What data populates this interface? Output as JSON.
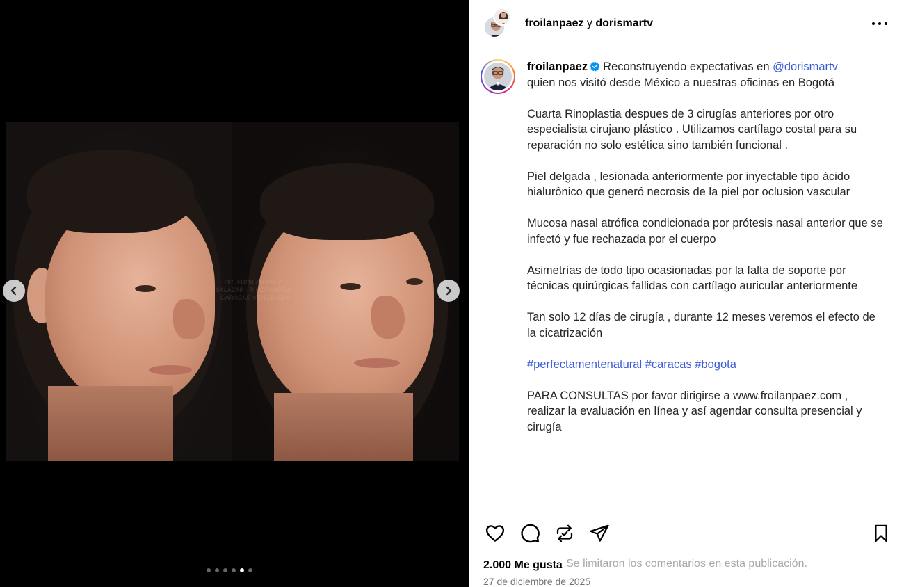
{
  "header": {
    "user1": "froilanpaez",
    "conjunction": "y",
    "user2": "dorismartv"
  },
  "icons": {
    "more": "more-horizontal-icon",
    "prev": "chevron-left-icon",
    "next": "chevron-right-icon",
    "verified": "verified-badge-icon",
    "like": "heart-icon",
    "comment": "comment-icon",
    "repost": "repost-icon",
    "share": "send-icon",
    "save": "bookmark-icon"
  },
  "media": {
    "dot_count": 6,
    "active_index": 4,
    "watermark": "DR. FROILAN PAEZ SALAZAR · RINOPLASTIA · CARACAS VENEZUELA"
  },
  "caption": {
    "username": "froilanpaez",
    "lead": "Reconstruyendo expectativas en ",
    "mention": "@dorismartv",
    "lead_rest": "quien nos visitó desde México a nuestras oficinas en Bogotá",
    "p2": "Cuarta Rinoplastia despues de 3 cirugías anteriores por otro especialista cirujano plástico . Utilizamos cartílago costal para su reparación no solo estética sino también funcional .",
    "p3": "Piel delgada , lesionada anteriormente por inyectable tipo ácido hialurônico que generó necrosis de la piel por oclusion vascular",
    "p4": "Mucosa nasal atrófica condicionada por prótesis nasal anterior que se infectó y fue rechazada por el cuerpo",
    "p5": "Asimetrías de todo tipo ocasionadas por la falta de soporte por técnicas quirúrgicas fallidas con cartílago auricular anteriormente",
    "p6": "Tan solo 12 días de cirugía , durante 12 meses veremos el efecto de la cicatrización",
    "hashtags": [
      "#perfectamentenatural",
      "#caracas",
      "#bogota"
    ],
    "p8": "PARA CONSULTAS por favor dirigirse a www.froilanpaez.com , realizar la evaluación en línea y así agendar consulta presencial y cirugía"
  },
  "stats": {
    "likes": "2.000 Me gusta",
    "date": "27 de diciembre de 2025"
  },
  "comments_note": "Se limitaron los comentarios en esta publicación.",
  "colors": {
    "link": "#3b5bd8",
    "verified": "#0095f6",
    "muted": "#737373"
  }
}
